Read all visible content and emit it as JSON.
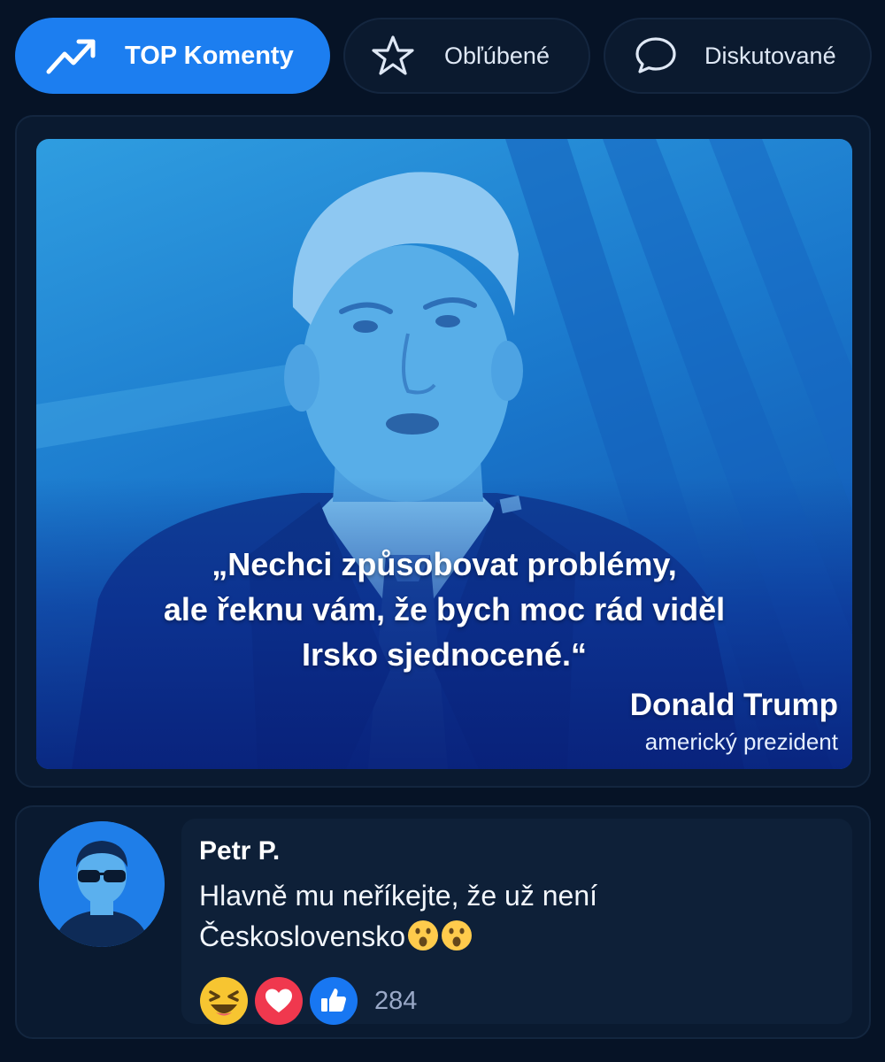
{
  "tabs": [
    {
      "label": "TOP Komenty",
      "icon": "trending-up-icon",
      "active": true
    },
    {
      "label": "Obľúbené",
      "icon": "star-icon",
      "active": false
    },
    {
      "label": "Diskutované",
      "icon": "speech-bubble-icon",
      "active": false
    }
  ],
  "post": {
    "image": "portrait-photo",
    "quote_lines": [
      "„Nechci způsobovat problémy,",
      "ale řeknu vám, že bych moc rád viděl",
      "Irsko sjednocené.“"
    ],
    "author": "Donald Trump",
    "author_role": "americký prezident"
  },
  "comment": {
    "avatar": "user-avatar-sunglasses",
    "user_name": "Petr P.",
    "text_line1": "Hlavně mu neříkejte, že už není",
    "text_line2": "Československo",
    "trailing_emoji": [
      "astonished-face",
      "astonished-face"
    ],
    "reactions": [
      "laughing-icon",
      "heart-icon",
      "thumbs-up-icon"
    ],
    "reaction_count": "284"
  },
  "colors": {
    "background": "#061326",
    "card": "#0a1a30",
    "accent": "#1c7ef0",
    "photo_tint": "#1a78cc"
  }
}
